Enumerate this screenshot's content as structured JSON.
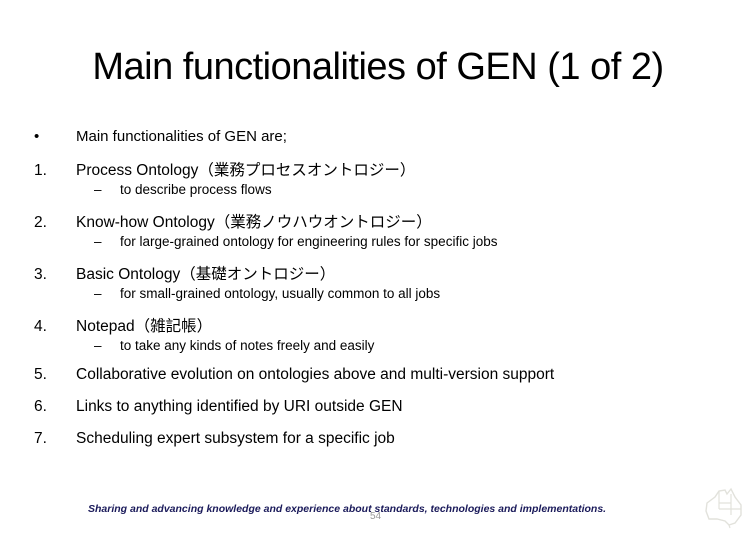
{
  "slide": {
    "title": "Main functionalities of GEN (1 of 2)",
    "intro": {
      "marker": "•",
      "text": "Main functionalities of GEN are;"
    },
    "items": [
      {
        "number": "1.",
        "text": "Process Ontology（業務プロセスオントロジー）",
        "sub": "to describe process flows"
      },
      {
        "number": "2.",
        "text": "Know-how Ontology（業務ノウハウオントロジー）",
        "sub": "for large-grained ontology for engineering rules for specific jobs"
      },
      {
        "number": "3.",
        "text": "Basic Ontology（基礎オントロジー）",
        "sub": "for small-grained ontology, usually common to all jobs"
      },
      {
        "number": "4.",
        "text": "Notepad（雑記帳）",
        "sub": "to take any kinds of notes freely and easily"
      },
      {
        "number": "5.",
        "text": "Collaborative evolution on ontologies above and multi-version support"
      },
      {
        "number": "6.",
        "text": "Links to anything identified by URI outside GEN"
      },
      {
        "number": "7.",
        "text": "Scheduling expert subsystem for a specific job"
      }
    ],
    "sub_marker": "–",
    "footer": "Sharing and advancing knowledge and experience about standards, technologies and implementations.",
    "page_number": "54",
    "logo": "australia-map-icon"
  }
}
